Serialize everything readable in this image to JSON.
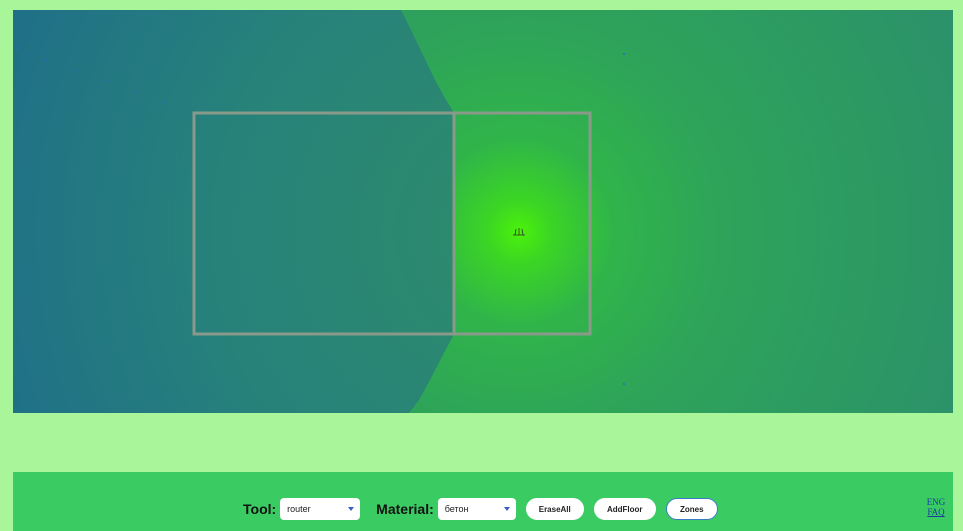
{
  "toolbar": {
    "tool_label": "Tool:",
    "tool_value": "router",
    "material_label": "Material:",
    "material_value": "бетон",
    "erase_all": "EraseAll",
    "add_floor": "AddFloor",
    "zones": "Zones"
  },
  "links": {
    "lang": "ENG",
    "faq": "FAQ"
  },
  "canvas": {
    "router_icon": "router-icon",
    "colors": {
      "signal_strong": "#4cf20a",
      "signal_medium": "#2ea35a",
      "signal_weak": "#1f7088",
      "wall": "#8a9a8a",
      "page_bg": "#a8f59a",
      "bottom_bar": "#3acb62"
    }
  }
}
